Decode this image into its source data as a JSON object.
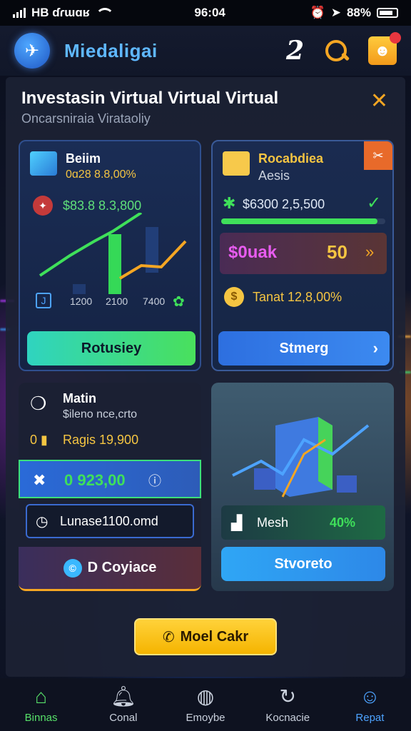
{
  "status_bar": {
    "carrier": "HB ɗɾɯɑʁ",
    "time": "96:04",
    "battery": "88%"
  },
  "header": {
    "app_name": "Miedaligai",
    "icon_number": "2"
  },
  "panel": {
    "title": "Investasin Virtual Virtual Virtual",
    "subtitle": "Oncarsniraia Virataoliy"
  },
  "card_chart": {
    "title": "Beiim",
    "subtitle": "0ɑ28 8.8,00%",
    "value": "$83.8 8.3,800",
    "x_labels": [
      "1200",
      "2100",
      "7400"
    ],
    "button_label": "Rotusiey",
    "colors": {
      "line1": "#3fe05a",
      "line2": "#f5a623",
      "button": "#2fd4c0"
    }
  },
  "card_balance": {
    "title": "Rocabdiea",
    "subtitle": "Aesis",
    "value": "$6300 2,5,500",
    "progress_fraction": 0.95,
    "highlight_label": "$0uak",
    "highlight_value": "50",
    "total_label": "Tanat 12,8,00%",
    "button_label": "Stmerg",
    "colors": {
      "progress": "#3fe05a",
      "highlight": "#e85cf0",
      "button": "#2e6ee0"
    }
  },
  "card_main": {
    "title": "Matin",
    "subtitle": "$ileno nce,crto",
    "rate": "Ragis 19,900",
    "amount": "0 923,00",
    "input_value": "Lunase1100.omd",
    "button_label": "D Coyiace"
  },
  "card_mesh": {
    "label": "Mesh",
    "value": "40%",
    "button_label": "Stvoreto"
  },
  "cta": {
    "label": "Moel Cakr"
  },
  "bottom_nav": [
    {
      "label": "Binnas",
      "icon": "home-icon"
    },
    {
      "label": "Conal",
      "icon": "bell-icon"
    },
    {
      "label": "Emoybe",
      "icon": "compass-icon"
    },
    {
      "label": "Kocnacie",
      "icon": "refresh-icon"
    },
    {
      "label": "Repat",
      "icon": "person-icon"
    }
  ]
}
